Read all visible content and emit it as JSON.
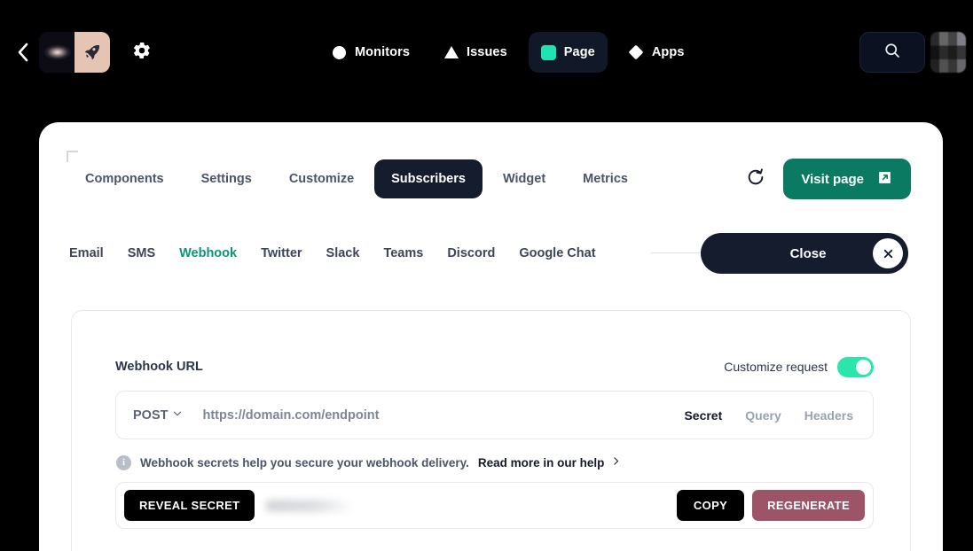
{
  "header": {
    "back_icon": "chevron-left-icon",
    "workspace": {
      "galaxy_thumb": "galaxy-image",
      "rocket_icon": "rocket-icon",
      "rocket_glyph": "🚀"
    },
    "settings_icon": "gear-icon",
    "nav": [
      {
        "label": "Monitors",
        "icon": "circle-icon",
        "active": false
      },
      {
        "label": "Issues",
        "icon": "triangle-icon",
        "active": false
      },
      {
        "label": "Page",
        "icon": "square-icon",
        "active": true
      },
      {
        "label": "Apps",
        "icon": "diamond-icon",
        "active": false
      }
    ],
    "search_icon": "search-icon",
    "avatar": "user-avatar",
    "accent_teal": "#1fe3b0",
    "nav_active_bg": "#111827"
  },
  "card": {
    "corner_mark": "corner-bracket",
    "tabs": [
      {
        "label": "Components",
        "active": false
      },
      {
        "label": "Settings",
        "active": false
      },
      {
        "label": "Customize",
        "active": false
      },
      {
        "label": "Subscribers",
        "active": true
      },
      {
        "label": "Widget",
        "active": false
      },
      {
        "label": "Metrics",
        "active": false
      }
    ],
    "refresh_icon": "refresh-icon",
    "visit_page": {
      "label": "Visit page",
      "icon": "external-link-icon",
      "bg": "#0a7b62"
    },
    "channels": [
      {
        "label": "Email",
        "active": false
      },
      {
        "label": "SMS",
        "active": false
      },
      {
        "label": "Webhook",
        "active": true
      },
      {
        "label": "Twitter",
        "active": false
      },
      {
        "label": "Slack",
        "active": false
      },
      {
        "label": "Teams",
        "active": false
      },
      {
        "label": "Discord",
        "active": false
      },
      {
        "label": "Google Chat",
        "active": false
      }
    ],
    "channel_active_color": "#0f9478",
    "close": {
      "label": "Close",
      "close_icon": "close-x-icon"
    }
  },
  "panel": {
    "title": "Webhook URL",
    "customize": {
      "label": "Customize request",
      "enabled": true,
      "on_color": "#2ae6ab"
    },
    "url": {
      "method": "POST",
      "method_caret": "chevron-down-icon",
      "placeholder": "https://domain.com/endpoint",
      "value": ""
    },
    "subtabs": [
      {
        "label": "Secret",
        "active": true
      },
      {
        "label": "Query",
        "active": false
      },
      {
        "label": "Headers",
        "active": false
      }
    ],
    "info": {
      "icon": "info-icon",
      "glyph": "i",
      "text": "Webhook secrets help you secure your webhook delivery.",
      "link_label": "Read more in our help",
      "link_chevron": "chevron-right-icon"
    },
    "secret": {
      "reveal_label": "REVEAL SECRET",
      "masked_value": "",
      "copy_label": "COPY",
      "regenerate_label": "REGENERATE",
      "regenerate_bg": "#9d5467"
    }
  }
}
